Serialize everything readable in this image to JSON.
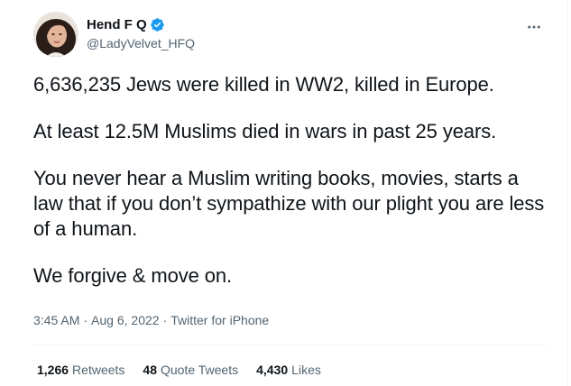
{
  "author": {
    "display_name": "Hend F Q",
    "handle": "@LadyVelvet_HFQ",
    "verified": true,
    "avatar_icon": "avatar-photo"
  },
  "tweet": {
    "paragraphs": [
      "6,636,235 Jews were killed in WW2, killed in Europe.",
      "At least 12.5M Muslims died in wars in past 25 years.",
      "You never hear a Muslim writing books, movies, starts a law that if you don’t sympathize with our plight you are less of a human.",
      "We forgive & move on."
    ]
  },
  "meta": {
    "time": "3:45 AM",
    "separator": "·",
    "date": "Aug 6, 2022",
    "source": "Twitter for iPhone"
  },
  "stats": {
    "retweets_count": "1,266",
    "retweets_label": "Retweets",
    "quotes_count": "48",
    "quotes_label": "Quote Tweets",
    "likes_count": "4,430",
    "likes_label": "Likes"
  },
  "colors": {
    "text": "#0f1419",
    "secondary": "#536471",
    "verified": "#1d9bf0",
    "divider": "#eff3f4"
  }
}
